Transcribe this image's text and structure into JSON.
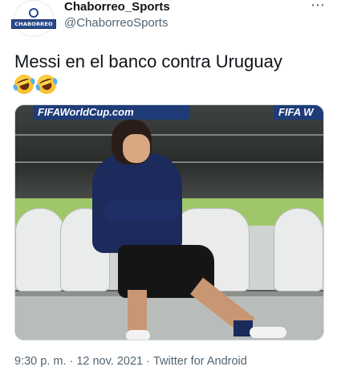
{
  "author": {
    "display_name": "Chaborreo_Sports",
    "handle": "@ChaborreoSports",
    "avatar_text": "CHABORREO"
  },
  "more_icon": "⋯",
  "tweet": {
    "text": "Messi en el banco contra Uruguay",
    "emojis": [
      "rolling-on-floor-laughing-icon",
      "rolling-on-floor-laughing-icon"
    ]
  },
  "photo": {
    "banner_left": "FIFAWorldCup.com",
    "banner_right": "FIFA W"
  },
  "meta": {
    "time": "9:30 p. m.",
    "date": "12 nov. 2021",
    "source": "Twitter for Android",
    "separator": "·"
  }
}
